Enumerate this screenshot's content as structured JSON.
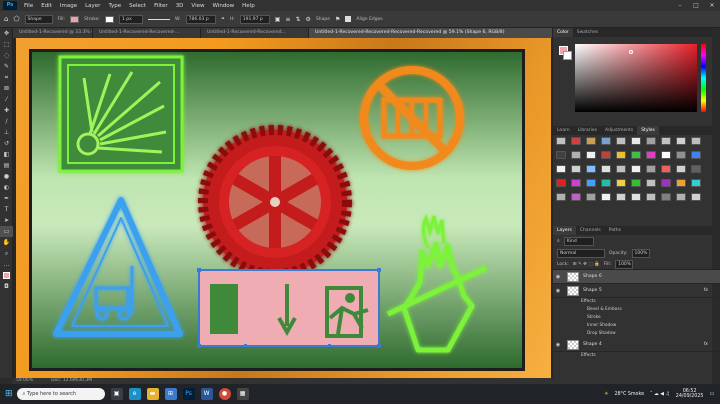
{
  "menu": {
    "logo": "Ps",
    "items": [
      "File",
      "Edit",
      "Image",
      "Layer",
      "Type",
      "Select",
      "Filter",
      "3D",
      "View",
      "Window",
      "Help"
    ]
  },
  "options": {
    "tool_mode": "Shape",
    "fill_label": "Fill:",
    "stroke_label": "Stroke:",
    "stroke_width": "1 px",
    "w_label": "W:",
    "w_value": "786.03 p",
    "h_label": "H:",
    "h_value": "191.97 p",
    "shape_label": "Shape",
    "align_edges": "Align Edges",
    "fill_color": "#f0a0a8"
  },
  "tabs": [
    "Untitled-1-Recovered @ 33.3% (...",
    "Untitled-1-Recovered-Recovered-...",
    "Untitled-1-Recovered-Recovered...",
    "Untitled-1-Recovered-Recovered-Recovered-Recovered @ 59.1% (Shape 6, RGB/8)"
  ],
  "status": {
    "zoom": "59.06%",
    "doc": "Doc: 12.6M/30.3M"
  },
  "color_panel": {
    "tabs": [
      "Color",
      "Swatches"
    ],
    "foreground": "#f2a3ab"
  },
  "styles_panel": {
    "tabs": [
      "Learn",
      "Libraries",
      "Adjustments",
      "Styles"
    ],
    "swatches": [
      "#c0c0c0",
      "#d04040",
      "#c8a050",
      "#7aa0d0",
      "#c0c0c0",
      "#e8e8e8",
      "#a0a0a0",
      "#c0c0c0",
      "#d0d0d0",
      "#bcbcbc",
      "#404040",
      "#b0b0b0",
      "#f0f0f0",
      "#c04040",
      "#e8c030",
      "#40c040",
      "#e040c0",
      "#ffffff",
      "#909090",
      "#4080f0",
      "#f0f0f0",
      "#d0d0d0",
      "#80c0ff",
      "#e0e0e0",
      "#c0c0c0",
      "#f0f0f0",
      "#a0a0a0",
      "#f06060",
      "#d0d0d0",
      "#606060",
      "#e02020",
      "#d040d0",
      "#40a0ff",
      "#20c0a0",
      "#f0d040",
      "#30c030",
      "#c0c0c0",
      "#a030c0",
      "#f0a030",
      "#30d0d0",
      "#b0b0b0",
      "#c060c0",
      "#a0a0a0",
      "#f0f0f0",
      "#d0d0d0",
      "#e0e0e0",
      "#c0c0c0",
      "#808080",
      "#b0b0b0",
      "#d0d0d0"
    ]
  },
  "layers_panel": {
    "tabs": [
      "Layers",
      "Channels",
      "Paths"
    ],
    "kind": "Kind",
    "blend": "Normal",
    "opacity_label": "Opacity:",
    "opacity": "100%",
    "lock_label": "Lock:",
    "fill_label": "Fill:",
    "fill": "100%",
    "rows": [
      {
        "name": "Shape 6",
        "selected": true,
        "fx": false
      },
      {
        "name": "Shape 5",
        "selected": false,
        "fx": true
      },
      {
        "name": "Shape 4",
        "selected": false,
        "fx": true
      }
    ],
    "effects_label": "Effects",
    "effects": [
      "Bevel & Emboss",
      "Stroke",
      "Inner Shadow",
      "Drop Shadow"
    ]
  },
  "taskbar": {
    "search_placeholder": "Type here to search",
    "weather": "28°C Smoke",
    "time": "06:52",
    "date": "24/09/2025"
  }
}
